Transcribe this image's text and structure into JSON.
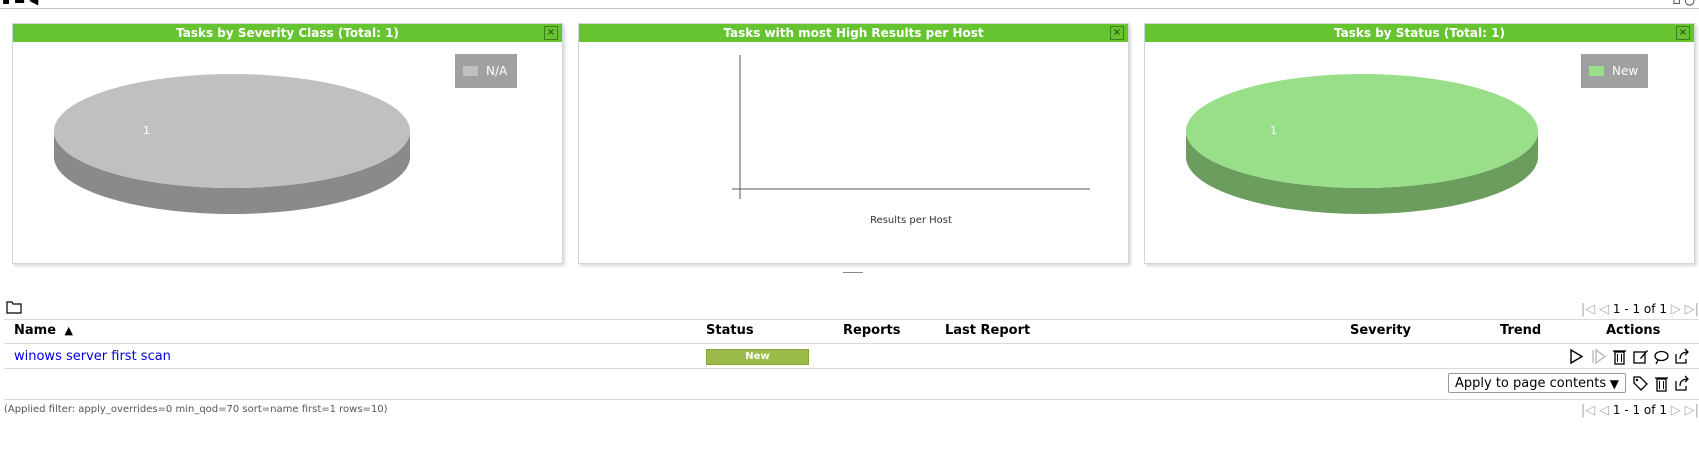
{
  "top": {
    "left_icons": "▪ ▬ ◀",
    "right_icons": "▫ ○"
  },
  "panels": [
    {
      "title": "Tasks by Severity Class (Total: 1)",
      "close_label": "×",
      "legend": [
        {
          "label": "N/A",
          "color": "#c0c0c0"
        }
      ],
      "chart_data": {
        "type": "pie",
        "categories": [
          "N/A"
        ],
        "values": [
          1
        ],
        "data_labels": [
          "1"
        ],
        "colors": {
          "top": "#c0c0c0",
          "side": "#8a8a8a"
        },
        "title": "Tasks by Severity Class (Total: 1)"
      }
    },
    {
      "title": "Tasks with most High Results per Host",
      "close_label": "×",
      "chart_data": {
        "type": "bar",
        "categories": [],
        "values": [],
        "xlabel": "Results per Host",
        "title": "Tasks with most High Results per Host"
      }
    },
    {
      "title": "Tasks by Status (Total: 1)",
      "close_label": "×",
      "legend": [
        {
          "label": "New",
          "color": "#99df8a"
        }
      ],
      "chart_data": {
        "type": "pie",
        "categories": [
          "New"
        ],
        "values": [
          1
        ],
        "data_labels": [
          "1"
        ],
        "colors": {
          "top": "#99df8a",
          "side": "#6a9d5e"
        },
        "title": "Tasks by Status (Total: 1)"
      }
    }
  ],
  "pager": {
    "text": "1 - 1 of 1",
    "first": "|◁",
    "prev": "◁",
    "next": "▷",
    "last": "▷|"
  },
  "table": {
    "headers": {
      "name": "Name",
      "sort_indicator": "▲",
      "status": "Status",
      "reports": "Reports",
      "last_report": "Last Report",
      "severity": "Severity",
      "trend": "Trend",
      "actions": "Actions"
    },
    "rows": [
      {
        "name": "winows server first scan",
        "status": "New",
        "status_color": "#9cbb4a"
      }
    ]
  },
  "bulk": {
    "select_value": "Apply to page contents",
    "select_arrow": "▼"
  },
  "filter": {
    "text": "(Applied filter: apply_overrides=0 min_qod=70 sort=name first=1 rows=10)"
  }
}
